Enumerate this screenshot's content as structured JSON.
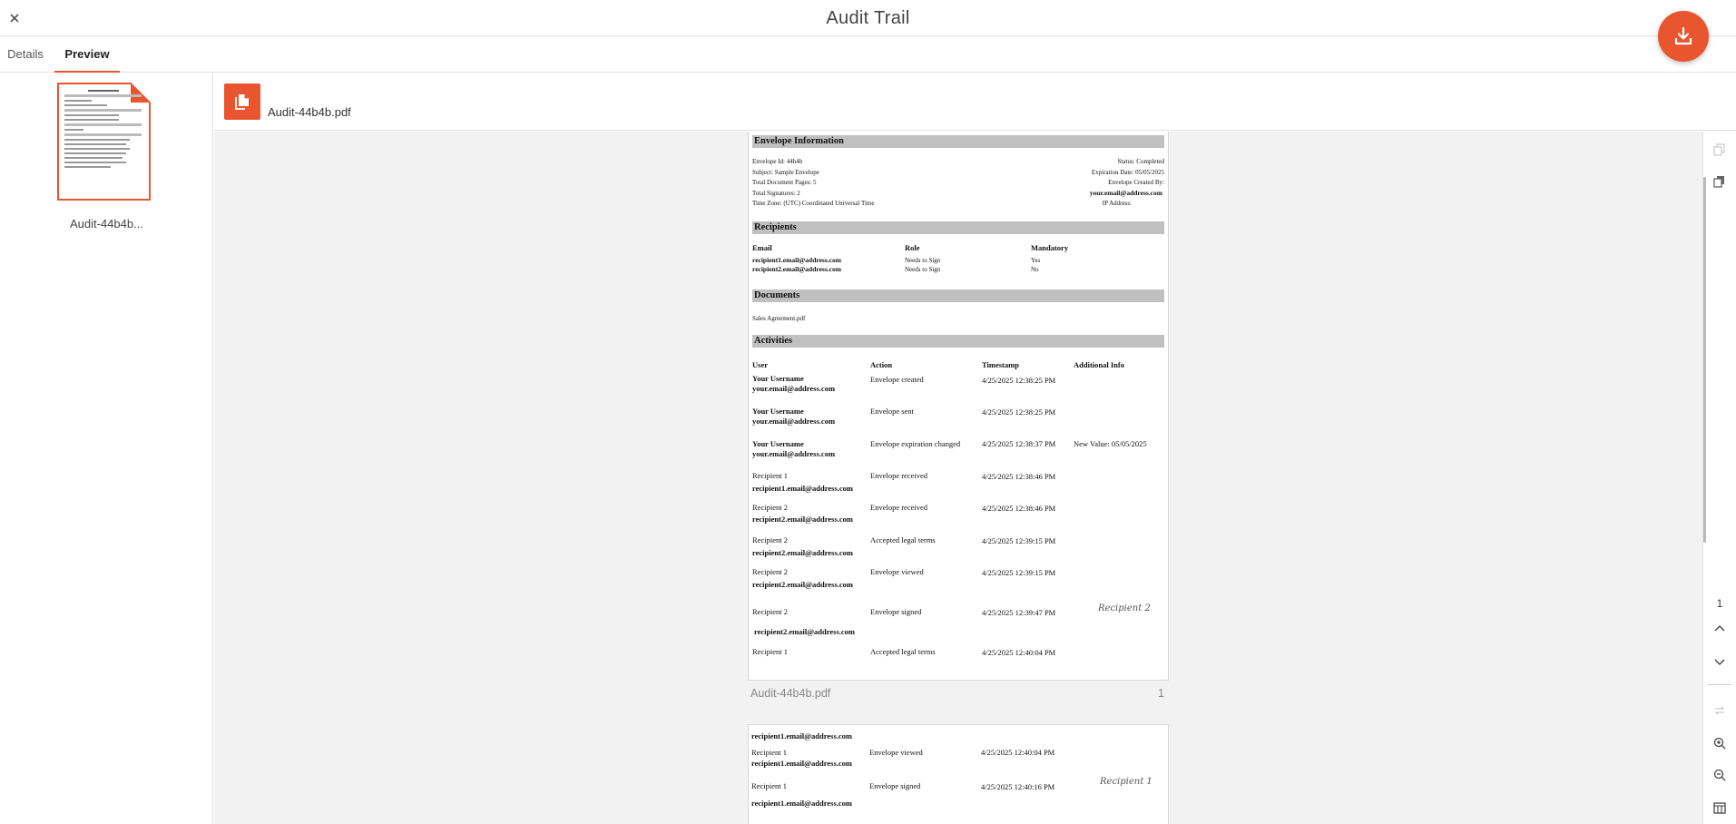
{
  "header": {
    "title": "Audit Trail"
  },
  "tabs": [
    {
      "label": "Details"
    },
    {
      "label": "Preview"
    }
  ],
  "thumbnail": {
    "name": "Audit-44b4b..."
  },
  "file": {
    "name": "Audit-44b4b.pdf"
  },
  "colors": {
    "accent": "#e8552f",
    "section_bg": "#c0c0c0"
  },
  "document": {
    "envelope": {
      "heading": "Envelope Information",
      "left": [
        "Envelope Id: 44b4b",
        "Subject: Sample Envelope",
        "Total Document Pages: 5",
        "Total Signatures: 2",
        "Time Zone: (UTC) Coordinated Universal Time"
      ],
      "right": [
        "Status: Completed",
        "Expiration Date: 05/05/2025",
        "Envelope Created By:",
        "your.email@address.com",
        "IP Address:"
      ]
    },
    "recipients": {
      "heading": "Recipients",
      "columns": [
        "Email",
        "Role",
        "Mandatory"
      ],
      "rows": [
        [
          "recipient1.email@address.com",
          "Needs to Sign",
          "Yes"
        ],
        [
          "recipient2.email@address.com",
          "Needs to Sign",
          "No"
        ]
      ]
    },
    "documents": {
      "heading": "Documents",
      "items": [
        "Sales Agreement.pdf"
      ]
    },
    "activities": {
      "heading": "Activities",
      "columns": [
        "User",
        "Action",
        "Timestamp",
        "Additional Info"
      ],
      "rows": [
        {
          "user": "Your Username",
          "email": "your.email@address.com",
          "action": "Envelope created",
          "ts": "4/25/2025 12:38:25 PM",
          "info": ""
        },
        {
          "user": "Your Username",
          "email": "your.email@address.com",
          "action": "Envelope sent",
          "ts": "4/25/2025 12:38:25 PM",
          "info": ""
        },
        {
          "user": "Your Username",
          "email": "your.email@address.com",
          "action": "Envelope expiration changed",
          "ts": "4/25/2025 12:38:37 PM",
          "info": "New Value: 05/05/2025"
        },
        {
          "user": "Recipient 1",
          "email": "recipient1.email@address.com",
          "action": "Envelope received",
          "ts": "4/25/2025 12:38:46 PM",
          "info": ""
        },
        {
          "user": "Recipient 2",
          "email": "recipient2.email@address.com",
          "action": "Envelope received",
          "ts": "4/25/2025 12:38:46 PM",
          "info": ""
        },
        {
          "user": "Recipient 2",
          "email": "recipient2.email@address.com",
          "action": "Accepted legal terms",
          "ts": "4/25/2025 12:39:15 PM",
          "info": ""
        },
        {
          "user": "Recipient 2",
          "email": "recipient2.email@address.com",
          "action": "Envelope viewed",
          "ts": "4/25/2025 12:39:15 PM",
          "info": ""
        },
        {
          "user": "Recipient 2",
          "email": "recipient2.email@address.com",
          "action": "Envelope signed",
          "ts": "4/25/2025 12:39:47 PM",
          "info": "Recipient 2"
        },
        {
          "user": "Recipient 1",
          "email": "",
          "action": "Accepted legal terms",
          "ts": "4/25/2025 12:40:04 PM",
          "info": ""
        }
      ]
    },
    "page2": {
      "lines": [
        {
          "user": "",
          "email": "recipient1.email@address.com"
        },
        {
          "user": "Recipient 1",
          "email": "recipient1.email@address.com",
          "action": "Envelope viewed",
          "ts": "4/25/2025 12:40:04 PM"
        },
        {
          "user": "Recipient 1",
          "email": "recipient1.email@address.com",
          "action": "Envelope signed",
          "ts": "4/25/2025 12:40:16 PM",
          "info": "Recipient 1"
        }
      ]
    }
  },
  "page_caption": {
    "name": "Audit-44b4b.pdf",
    "number": "1"
  },
  "toolbar": {
    "page_number": "1"
  }
}
